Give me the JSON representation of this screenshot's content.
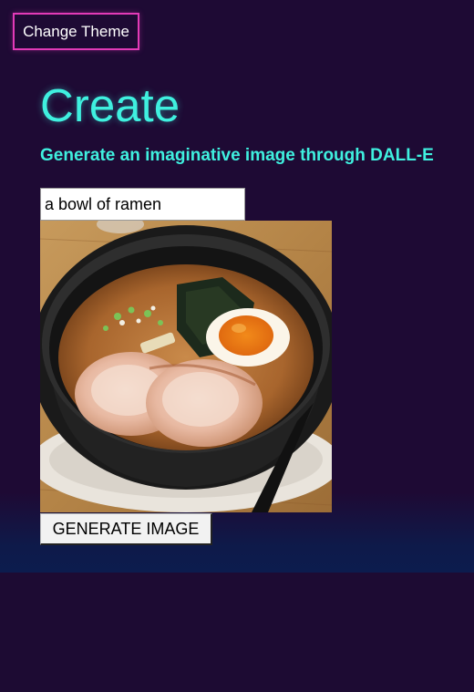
{
  "theme_button": {
    "label": "Change Theme"
  },
  "header": {
    "title": "Create",
    "subtitle": "Generate an imaginative image through DALL-E"
  },
  "prompt": {
    "value": "a bowl of ramen"
  },
  "generate_button": {
    "label": "GENERATE IMAGE"
  },
  "colors": {
    "background": "#1d0b33",
    "accent_pink": "#e23ab7",
    "accent_cyan": "#3ff0df",
    "gradient_bottom": "#0c1c4e"
  }
}
